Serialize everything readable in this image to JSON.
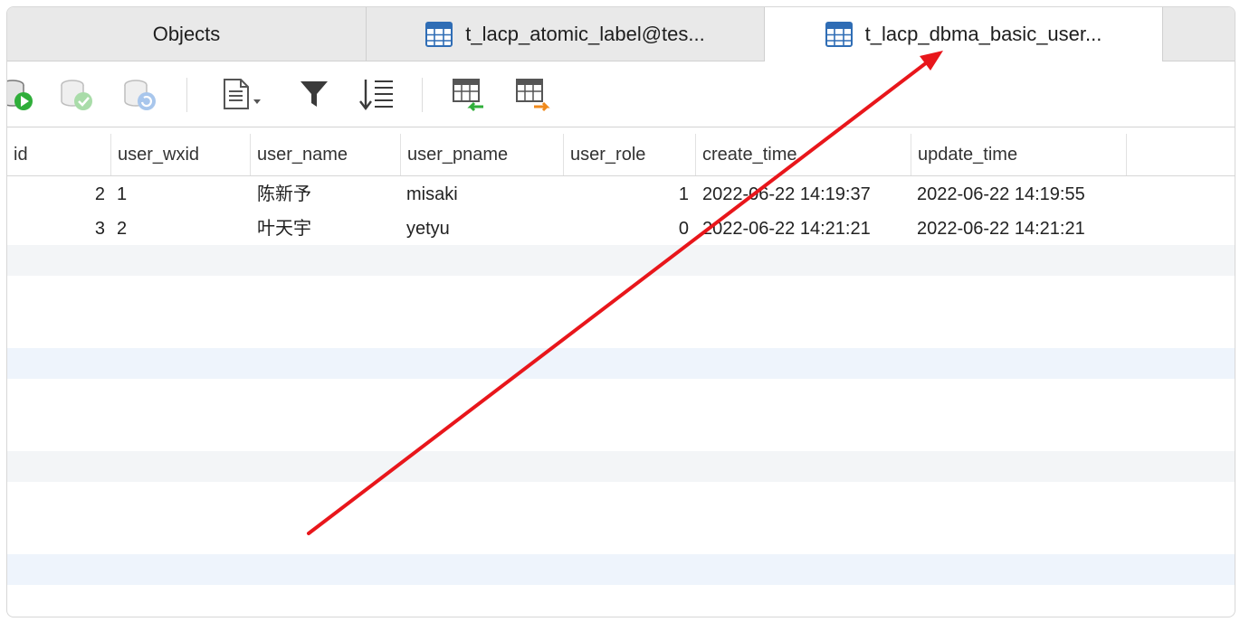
{
  "tabs": [
    {
      "label": "Objects"
    },
    {
      "label": "t_lacp_atomic_label@tes..."
    },
    {
      "label": "t_lacp_dbma_basic_user..."
    }
  ],
  "toolbar": {
    "icons": [
      "run-query-icon",
      "commit-icon",
      "refresh-icon",
      "text-view-icon",
      "filter-icon",
      "sort-icon",
      "import-icon",
      "export-icon"
    ]
  },
  "table": {
    "columns": [
      "id",
      "user_wxid",
      "user_name",
      "user_pname",
      "user_role",
      "create_time",
      "update_time"
    ],
    "rows": [
      {
        "id": "2",
        "user_wxid": "1",
        "user_name": "陈新予",
        "user_pname": "misaki",
        "user_role": "1",
        "create_time": "2022-06-22 14:19:37",
        "update_time": "2022-06-22 14:19:55"
      },
      {
        "id": "3",
        "user_wxid": "2",
        "user_name": "叶天宇",
        "user_pname": "yetyu",
        "user_role": "0",
        "create_time": "2022-06-22 14:21:21",
        "update_time": "2022-06-22 14:21:21"
      }
    ]
  },
  "colors": {
    "annotation_arrow": "#e8161b",
    "row_stripe": "#eef4fc",
    "tab_active": "#ffffff",
    "tab_inactive": "#e9e9e9"
  }
}
